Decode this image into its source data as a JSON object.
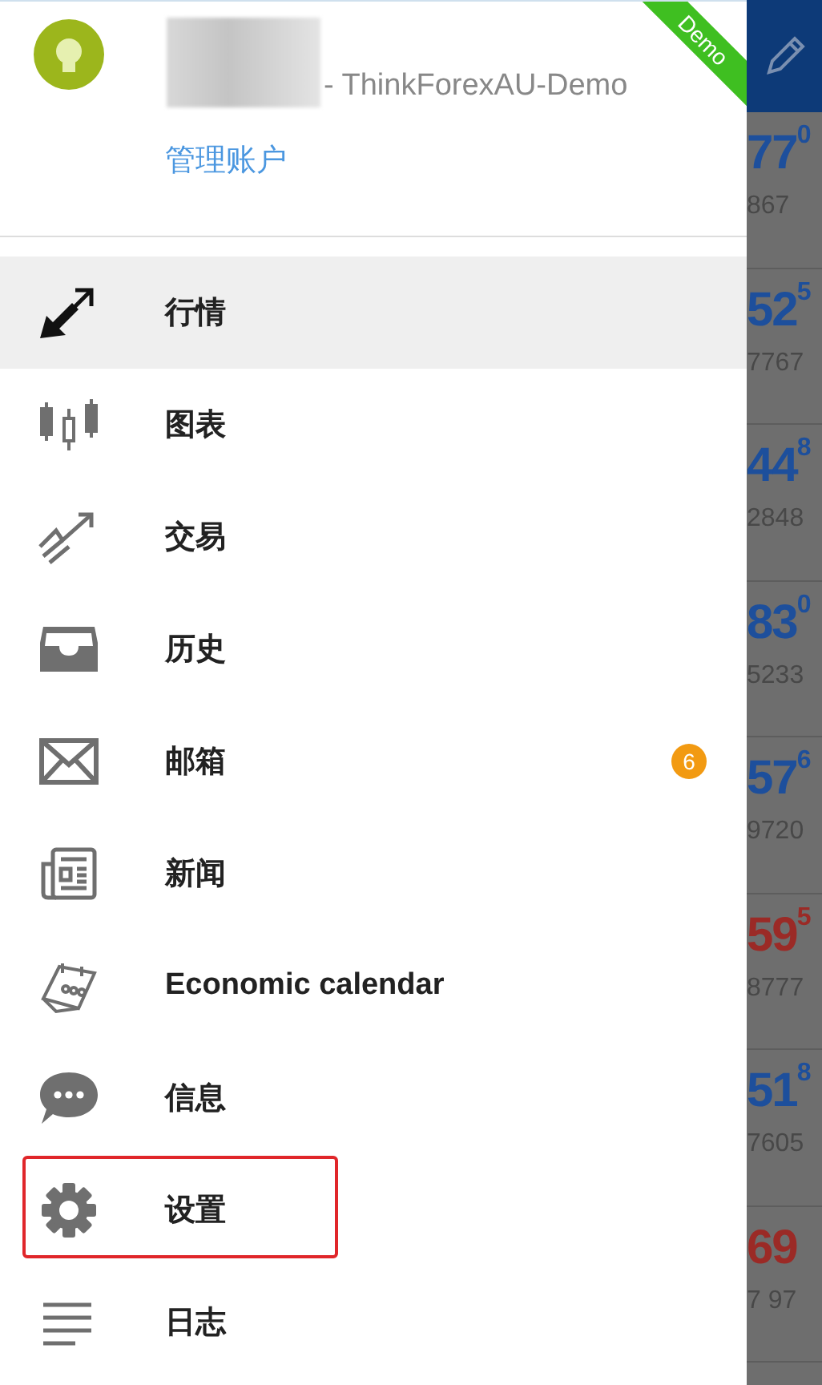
{
  "account": {
    "server": "- ThinkForexAU-Demo",
    "manage_link": "管理账户",
    "ribbon": "Demo"
  },
  "menu": [
    {
      "kind": "quotes",
      "label": "行情",
      "selected": true,
      "highlighted": false
    },
    {
      "kind": "chart",
      "label": "图表",
      "selected": false,
      "highlighted": false
    },
    {
      "kind": "trade",
      "label": "交易",
      "selected": false,
      "highlighted": false
    },
    {
      "kind": "history",
      "label": "历史",
      "selected": false,
      "highlighted": false
    },
    {
      "kind": "mail",
      "label": "邮箱",
      "selected": false,
      "highlighted": false,
      "badge": "6"
    },
    {
      "kind": "news",
      "label": "新闻",
      "selected": false,
      "highlighted": false
    },
    {
      "kind": "calendar",
      "label": "Economic calendar",
      "selected": false,
      "highlighted": false
    },
    {
      "kind": "messages",
      "label": "信息",
      "selected": false,
      "highlighted": false
    },
    {
      "kind": "settings",
      "label": "设置",
      "selected": false,
      "highlighted": true
    },
    {
      "kind": "journal",
      "label": "日志",
      "selected": false,
      "highlighted": false
    }
  ],
  "quotes": [
    {
      "price": "77",
      "pip": "0",
      "low": "867",
      "color": "#1d4f9c"
    },
    {
      "price": "52",
      "pip": "5",
      "low": "7767",
      "color": "#1d4f9c"
    },
    {
      "price": "44",
      "pip": "8",
      "low": "2848",
      "color": "#1d4f9c"
    },
    {
      "price": "83",
      "pip": "0",
      "low": "5233",
      "color": "#1d4f9c"
    },
    {
      "price": "57",
      "pip": "6",
      "low": "9720",
      "color": "#1d4f9c"
    },
    {
      "price": "59",
      "pip": "5",
      "low": "8777",
      "color": "#9b2a26"
    },
    {
      "price": "51",
      "pip": "8",
      "low": "7605",
      "color": "#1d4f9c"
    },
    {
      "price": "69",
      "low": "7 97",
      "color": "#9b2a26"
    }
  ]
}
